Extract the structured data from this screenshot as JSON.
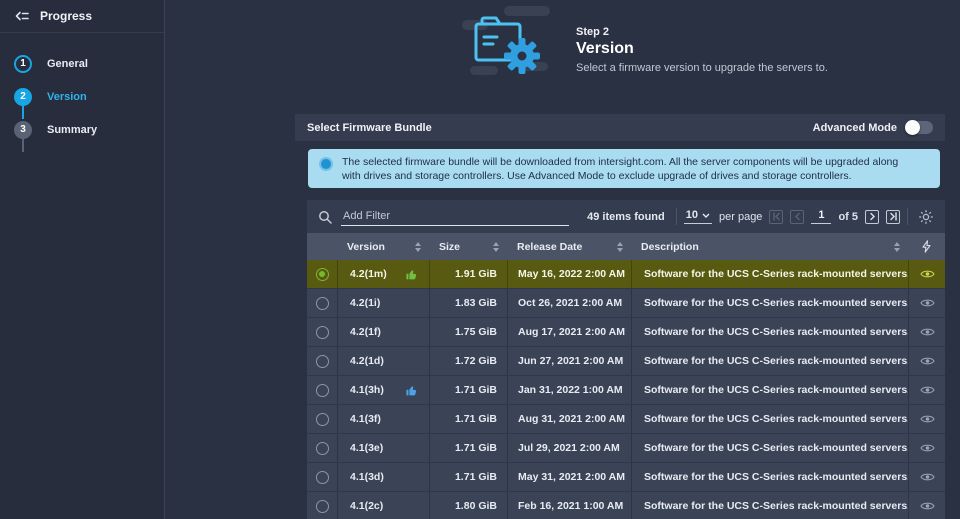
{
  "colors": {
    "accent_blue": "#18a5e3",
    "selected_row_bg": "#575a10",
    "selected_radio_green": "#7cb82f",
    "banner_bg": "#a9dbf1",
    "banner_text": "#20304a",
    "badge_green": "#72bf44",
    "badge_blue": "#4aa3e8"
  },
  "sidebar": {
    "title": "Progress",
    "steps": [
      {
        "number": "1",
        "label": "General",
        "state": "done"
      },
      {
        "number": "2",
        "label": "Version",
        "state": "active"
      },
      {
        "number": "3",
        "label": "Summary",
        "state": "pending"
      }
    ]
  },
  "header": {
    "step_label": "Step 2",
    "title": "Version",
    "subtitle": "Select a firmware version to upgrade the servers to."
  },
  "panel": {
    "title": "Select Firmware Bundle",
    "advanced_mode_label": "Advanced Mode",
    "advanced_mode_enabled": false
  },
  "banner": {
    "text": "The selected firmware bundle will be downloaded from intersight.com. All the server components will be upgraded along with drives and storage controllers. Use Advanced Mode to exclude upgrade of drives and storage controllers."
  },
  "toolbar": {
    "filter_placeholder": "Add Filter",
    "items_found": "49 items found",
    "page_size": "10",
    "per_page_label": "per page",
    "current_page": "1",
    "total_pages_label": "of 5"
  },
  "table": {
    "columns": [
      {
        "key": "version",
        "label": "Version"
      },
      {
        "key": "size",
        "label": "Size"
      },
      {
        "key": "date",
        "label": "Release Date"
      },
      {
        "key": "description",
        "label": "Description"
      }
    ],
    "rows": [
      {
        "version": "4.2(1m)",
        "badge": "green",
        "size": "1.91 GiB",
        "date": "May 16, 2022 2:00 AM",
        "description": "Software for the UCS C-Series rack-mounted servers. This is software…",
        "selected": true
      },
      {
        "version": "4.2(1i)",
        "badge": null,
        "size": "1.83 GiB",
        "date": "Oct 26, 2021 2:00 AM",
        "description": "Software for the UCS C-Series rack-mounted servers. This is software…",
        "selected": false
      },
      {
        "version": "4.2(1f)",
        "badge": null,
        "size": "1.75 GiB",
        "date": "Aug 17, 2021 2:00 AM",
        "description": "Software for the UCS C-Series rack-mounted servers. This is software…",
        "selected": false
      },
      {
        "version": "4.2(1d)",
        "badge": null,
        "size": "1.72 GiB",
        "date": "Jun 27, 2021 2:00 AM",
        "description": "Software for the UCS C-Series rack-mounted servers. This is software…",
        "selected": false
      },
      {
        "version": "4.1(3h)",
        "badge": "blue",
        "size": "1.71 GiB",
        "date": "Jan 31, 2022 1:00 AM",
        "description": "Software for the UCS C-Series rack-mounted servers. This is software…",
        "selected": false
      },
      {
        "version": "4.1(3f)",
        "badge": null,
        "size": "1.71 GiB",
        "date": "Aug 31, 2021 2:00 AM",
        "description": "Software for the UCS C-Series rack-mounted servers. This is software…",
        "selected": false
      },
      {
        "version": "4.1(3e)",
        "badge": null,
        "size": "1.71 GiB",
        "date": "Jul 29, 2021 2:00 AM",
        "description": "Software for the UCS C-Series rack-mounted servers. This is software…",
        "selected": false
      },
      {
        "version": "4.1(3d)",
        "badge": null,
        "size": "1.71 GiB",
        "date": "May 31, 2021 2:00 AM",
        "description": "Software for the UCS C-Series rack-mounted servers. This is software…",
        "selected": false
      },
      {
        "version": "4.1(2c)",
        "badge": null,
        "size": "1.80 GiB",
        "date": "Feb 16, 2021 1:00 AM",
        "description": "Software for the UCS C-Series rack-mounted servers. This is software…",
        "selected": false
      }
    ]
  }
}
